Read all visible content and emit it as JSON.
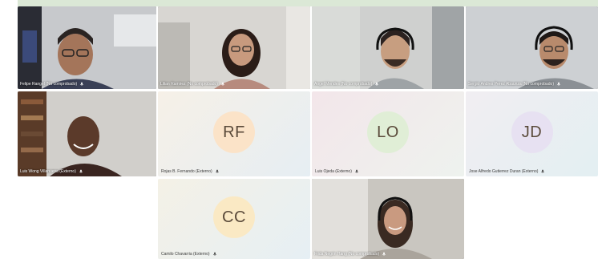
{
  "participants": [
    {
      "name": "Felipe Rangel (No comprobado)",
      "type": "video"
    },
    {
      "name": "Lilian Ramirez (No comprobado)",
      "type": "video"
    },
    {
      "name": "Angel Mendes (No comprobado)",
      "type": "video"
    },
    {
      "name": "Sergio Andres Perez Abaunza (No comprobado)",
      "type": "video"
    },
    {
      "name": "Luis Wong Villanueva (Externo)",
      "type": "video"
    },
    {
      "name": "Rojas B. Fernando (Externo)",
      "type": "avatar",
      "initials": "RF",
      "avatar_color": "#fbe3c8"
    },
    {
      "name": "Luis Ojeda (Externo)",
      "type": "avatar",
      "initials": "LO",
      "avatar_color": "#e0eed6"
    },
    {
      "name": "Jose Alfredo Gutierrez Duran (Externo)",
      "type": "avatar",
      "initials": "JD",
      "avatar_color": "#e7e1f2"
    },
    {
      "name": "Camilo Chavarria (Externo)",
      "type": "avatar",
      "initials": "CC",
      "avatar_color": "#fae9c4"
    },
    {
      "name": "Frida Negrin Hang (No comprobado)",
      "type": "video"
    }
  ],
  "icons": {
    "mic": "microphone-icon"
  }
}
